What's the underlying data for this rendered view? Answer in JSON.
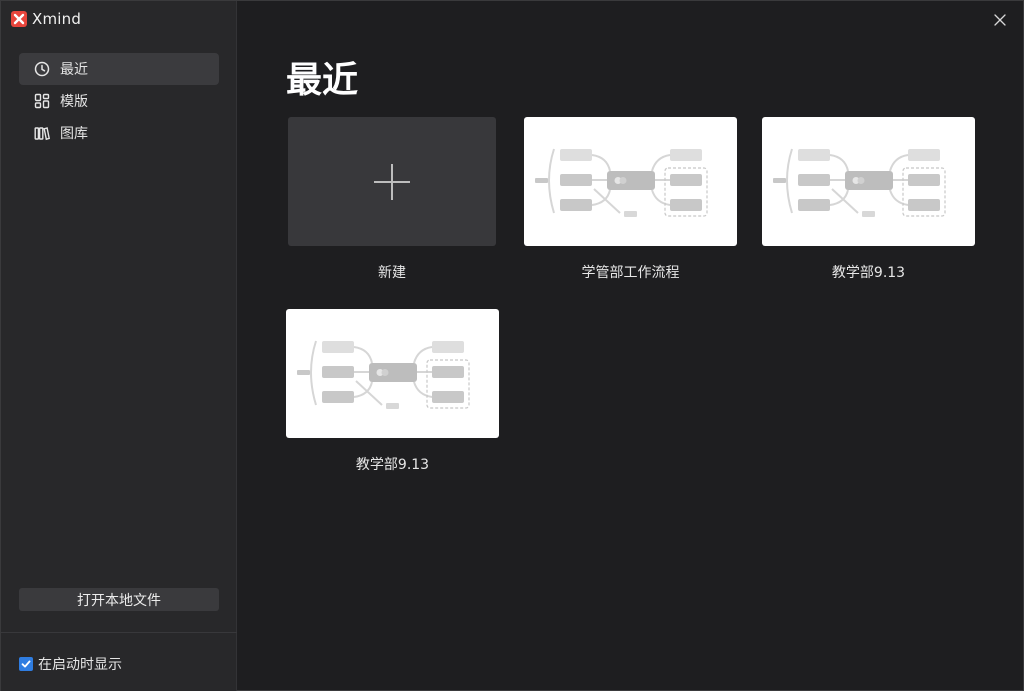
{
  "app": {
    "name": "Xmind"
  },
  "sidebar": {
    "items": [
      {
        "label": "最近",
        "icon": "clock-icon",
        "active": true
      },
      {
        "label": "模版",
        "icon": "template-grid-icon",
        "active": false
      },
      {
        "label": "图库",
        "icon": "library-books-icon",
        "active": false
      }
    ],
    "open_local_label": "打开本地文件",
    "startup_label": "在启动时显示",
    "startup_checked": true
  },
  "main": {
    "title": "最近",
    "new_label": "新建",
    "files": [
      {
        "label": "学管部工作流程"
      },
      {
        "label": "教学部9.13"
      },
      {
        "label": "教学部9.13"
      }
    ]
  },
  "colors": {
    "sidebar_bg": "#28282a",
    "main_bg": "#1e1e20",
    "accent": "#2f7de1",
    "logo": "#e8453c"
  }
}
